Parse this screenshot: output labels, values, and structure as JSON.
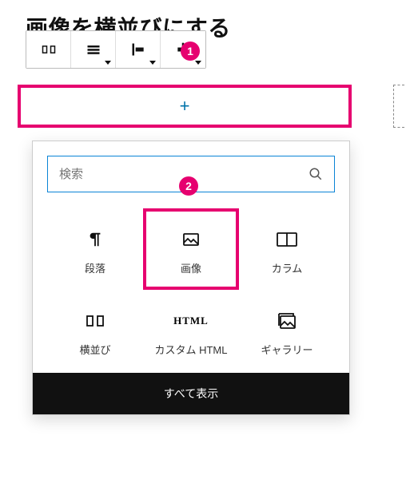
{
  "title": "画像を横並びにする",
  "add_button": {
    "plus": "+"
  },
  "search": {
    "placeholder": "検索"
  },
  "blocks": [
    {
      "label": "段落"
    },
    {
      "label": "画像"
    },
    {
      "label": "カラム"
    },
    {
      "label": "横並び"
    },
    {
      "label": "カスタム HTML"
    },
    {
      "label": "ギャラリー"
    }
  ],
  "html_icon": "HTML",
  "footer": "すべて表示",
  "callouts": {
    "one": "1",
    "two": "2"
  }
}
